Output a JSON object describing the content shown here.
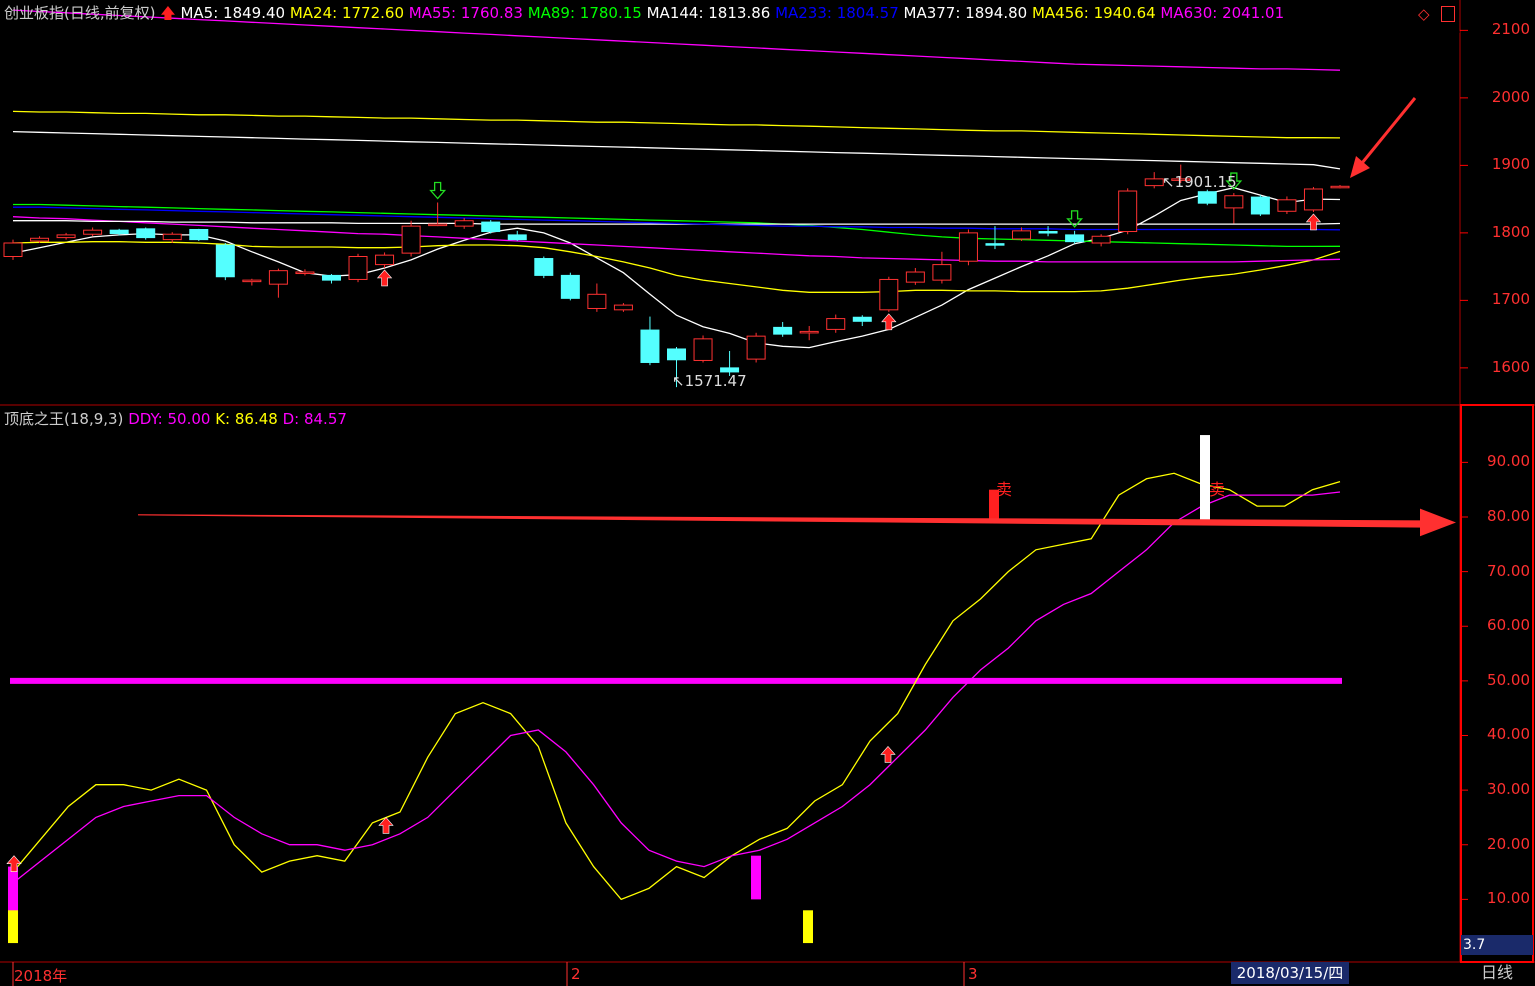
{
  "main_header": {
    "index_name": "创业板指(日线,前复权)",
    "ma": [
      {
        "label": "MA5: 1849.40",
        "color": "#ffffff"
      },
      {
        "label": "MA24: 1772.60",
        "color": "#ffff00"
      },
      {
        "label": "MA55: 1760.83",
        "color": "#ff00ff"
      },
      {
        "label": "MA89: 1780.15",
        "color": "#00ff00"
      },
      {
        "label": "MA144: 1813.86",
        "color": "#ffffff"
      },
      {
        "label": "MA233: 1804.57",
        "color": "#0000ff"
      },
      {
        "label": "MA377: 1894.80",
        "color": "#ffffff"
      },
      {
        "label": "MA456: 1940.64",
        "color": "#ffff00"
      },
      {
        "label": "MA630: 2041.01",
        "color": "#ff00ff"
      }
    ],
    "icons": [
      "diamond-icon",
      "panel-toggle-icon"
    ]
  },
  "sub_header": {
    "name": "顶底之王(18,9,3)",
    "ddy": "DDY: 50.00",
    "k": "K: 86.48",
    "d": "D: 84.57"
  },
  "price_axis": [
    "2100",
    "2000",
    "1900",
    "1800",
    "1700",
    "1600"
  ],
  "indicator_axis": [
    "90.00",
    "80.00",
    "70.00",
    "60.00",
    "50.00",
    "40.00",
    "30.00",
    "20.00",
    "10.00"
  ],
  "bottom_bar": {
    "dates": [
      "2018年",
      "2",
      "3"
    ],
    "cursor_date": "2018/03/15/四",
    "cursor_value": "3.7",
    "period_button": "日线"
  },
  "annotations": {
    "high_label": "1901.15",
    "low_label": "1571.47",
    "sell_label_1": "卖",
    "sell_label_2": "卖"
  },
  "chart_data": [
    {
      "type": "candlestick",
      "title": "创业板指(日线,前复权)",
      "ylim": [
        1545,
        2145
      ],
      "candles": [
        {
          "o": 1765,
          "c": 1785,
          "h": 1790,
          "l": 1760
        },
        {
          "o": 1788,
          "c": 1792,
          "h": 1795,
          "l": 1785
        },
        {
          "o": 1793,
          "c": 1797,
          "h": 1800,
          "l": 1790
        },
        {
          "o": 1798,
          "c": 1804,
          "h": 1808,
          "l": 1795
        },
        {
          "o": 1804,
          "c": 1799,
          "h": 1806,
          "l": 1796
        },
        {
          "o": 1806,
          "c": 1793,
          "h": 1808,
          "l": 1790
        },
        {
          "o": 1790,
          "c": 1798,
          "h": 1801,
          "l": 1785
        },
        {
          "o": 1805,
          "c": 1790,
          "h": 1806,
          "l": 1788
        },
        {
          "o": 1782,
          "c": 1735,
          "h": 1785,
          "l": 1730
        },
        {
          "o": 1728,
          "c": 1730,
          "h": 1732,
          "l": 1722
        },
        {
          "o": 1724,
          "c": 1744,
          "h": 1747,
          "l": 1704
        },
        {
          "o": 1740,
          "c": 1742,
          "h": 1746,
          "l": 1737
        },
        {
          "o": 1737,
          "c": 1730,
          "h": 1739,
          "l": 1725
        },
        {
          "o": 1731,
          "c": 1765,
          "h": 1769,
          "l": 1727
        },
        {
          "o": 1753,
          "c": 1767,
          "h": 1771,
          "l": 1748
        },
        {
          "o": 1770,
          "c": 1810,
          "h": 1818,
          "l": 1765
        },
        {
          "o": 1812,
          "c": 1813,
          "h": 1845,
          "l": 1810
        },
        {
          "o": 1810,
          "c": 1818,
          "h": 1822,
          "l": 1806
        },
        {
          "o": 1816,
          "c": 1802,
          "h": 1819,
          "l": 1799
        },
        {
          "o": 1797,
          "c": 1790,
          "h": 1803,
          "l": 1788
        },
        {
          "o": 1762,
          "c": 1737,
          "h": 1765,
          "l": 1733
        },
        {
          "o": 1737,
          "c": 1703,
          "h": 1741,
          "l": 1700
        },
        {
          "o": 1688,
          "c": 1709,
          "h": 1725,
          "l": 1683
        },
        {
          "o": 1686,
          "c": 1693,
          "h": 1696,
          "l": 1683
        },
        {
          "o": 1656,
          "c": 1608,
          "h": 1676,
          "l": 1604
        },
        {
          "o": 1628,
          "c": 1612,
          "h": 1631,
          "l": 1571.47
        },
        {
          "o": 1611,
          "c": 1643,
          "h": 1648,
          "l": 1608
        },
        {
          "o": 1600,
          "c": 1594,
          "h": 1625,
          "l": 1588
        },
        {
          "o": 1613,
          "c": 1647,
          "h": 1652,
          "l": 1608
        },
        {
          "o": 1660,
          "c": 1650,
          "h": 1668,
          "l": 1646
        },
        {
          "o": 1652,
          "c": 1654,
          "h": 1662,
          "l": 1641
        },
        {
          "o": 1657,
          "c": 1673,
          "h": 1679,
          "l": 1652
        },
        {
          "o": 1675,
          "c": 1669,
          "h": 1678,
          "l": 1662
        },
        {
          "o": 1686,
          "c": 1731,
          "h": 1735,
          "l": 1683
        },
        {
          "o": 1727,
          "c": 1742,
          "h": 1748,
          "l": 1723
        },
        {
          "o": 1730,
          "c": 1753,
          "h": 1772,
          "l": 1725
        },
        {
          "o": 1758,
          "c": 1800,
          "h": 1805,
          "l": 1752
        },
        {
          "o": 1784,
          "c": 1782,
          "h": 1810,
          "l": 1776
        },
        {
          "o": 1791,
          "c": 1803,
          "h": 1808,
          "l": 1788
        },
        {
          "o": 1802,
          "c": 1800,
          "h": 1810,
          "l": 1795
        },
        {
          "o": 1797,
          "c": 1787,
          "h": 1803,
          "l": 1784
        },
        {
          "o": 1785,
          "c": 1795,
          "h": 1798,
          "l": 1780
        },
        {
          "o": 1802,
          "c": 1862,
          "h": 1866,
          "l": 1798
        },
        {
          "o": 1870,
          "c": 1880,
          "h": 1890,
          "l": 1866
        },
        {
          "o": 1880,
          "c": 1880,
          "h": 1901.15,
          "l": 1874
        },
        {
          "o": 1861,
          "c": 1844,
          "h": 1864,
          "l": 1841
        },
        {
          "o": 1837,
          "c": 1855,
          "h": 1859,
          "l": 1814
        },
        {
          "o": 1853,
          "c": 1828,
          "h": 1856,
          "l": 1825
        },
        {
          "o": 1832,
          "c": 1849,
          "h": 1854,
          "l": 1828
        },
        {
          "o": 1834,
          "c": 1865,
          "h": 1868,
          "l": 1831
        },
        {
          "o": 1868,
          "c": 1869,
          "h": 1871,
          "l": 1866
        }
      ],
      "moving_averages": [
        {
          "name": "MA5",
          "color": "#ffffff",
          "values": [
            1770,
            1778,
            1786,
            1794,
            1797,
            1799,
            1797,
            1797,
            1788,
            1772,
            1757,
            1741,
            1736,
            1738,
            1748,
            1760,
            1776,
            1789,
            1801,
            1807,
            1800,
            1785,
            1763,
            1741,
            1709,
            1678,
            1661,
            1651,
            1637,
            1632,
            1630,
            1639,
            1647,
            1657,
            1675,
            1693,
            1716,
            1733,
            1750,
            1766,
            1784,
            1792,
            1804,
            1825,
            1848,
            1858,
            1867,
            1856,
            1845,
            1850,
            1849.4
          ]
        },
        {
          "name": "MA24",
          "color": "#ffff00",
          "values": [
            1785,
            1786,
            1786,
            1787,
            1787,
            1786,
            1786,
            1785,
            1783,
            1780,
            1779,
            1779,
            1779,
            1778,
            1778,
            1779,
            1781,
            1782,
            1782,
            1781,
            1778,
            1772,
            1765,
            1757,
            1748,
            1737,
            1730,
            1725,
            1720,
            1715,
            1712,
            1712,
            1712,
            1713,
            1715,
            1715,
            1714,
            1714,
            1713,
            1713,
            1713,
            1714,
            1718,
            1724,
            1730,
            1735,
            1739,
            1745,
            1752,
            1760,
            1772.6
          ]
        },
        {
          "name": "MA55",
          "color": "#ff00ff",
          "values": [
            1824,
            1822,
            1821,
            1819,
            1817,
            1815,
            1813,
            1811,
            1809,
            1807,
            1805,
            1803,
            1801,
            1799,
            1798,
            1796,
            1794,
            1792,
            1790,
            1788,
            1786,
            1784,
            1782,
            1780,
            1778,
            1776,
            1774,
            1772,
            1770,
            1768,
            1766,
            1765,
            1763,
            1762,
            1761,
            1760,
            1759,
            1758,
            1758,
            1757,
            1757,
            1757,
            1757,
            1757,
            1757,
            1757,
            1757,
            1758,
            1759,
            1760,
            1760.83
          ]
        },
        {
          "name": "MA89",
          "color": "#00ff00",
          "values": [
            1842,
            1842,
            1841,
            1840,
            1839,
            1838,
            1837,
            1836,
            1835,
            1834,
            1833,
            1832,
            1831,
            1830,
            1829,
            1828,
            1827,
            1826,
            1825,
            1824,
            1823,
            1822,
            1821,
            1820,
            1819,
            1818,
            1817,
            1816,
            1815,
            1813,
            1811,
            1808,
            1805,
            1801,
            1797,
            1794,
            1792,
            1791,
            1790,
            1789,
            1788,
            1787,
            1786,
            1785,
            1784,
            1783,
            1782,
            1781,
            1780,
            1780,
            1780.15
          ]
        },
        {
          "name": "MA144",
          "color": "#ffffff",
          "values": [
            1818,
            1818,
            1818,
            1817,
            1817,
            1817,
            1816,
            1816,
            1816,
            1815,
            1815,
            1815,
            1815,
            1814,
            1814,
            1814,
            1814,
            1814,
            1813,
            1813,
            1813,
            1813,
            1813,
            1813,
            1813,
            1813,
            1813,
            1813,
            1813,
            1813,
            1813,
            1813,
            1813,
            1813,
            1813,
            1813,
            1813,
            1813,
            1813,
            1813,
            1813,
            1813,
            1813,
            1813,
            1813,
            1813,
            1813,
            1813,
            1813,
            1813,
            1813.86
          ]
        },
        {
          "name": "MA233",
          "color": "#0000ff",
          "values": [
            1838,
            1838,
            1837,
            1836,
            1835,
            1834,
            1833,
            1832,
            1831,
            1830,
            1829,
            1828,
            1827,
            1826,
            1825,
            1824,
            1823,
            1822,
            1821,
            1820,
            1819,
            1818,
            1817,
            1816,
            1815,
            1814,
            1813,
            1812,
            1811,
            1810,
            1810,
            1809,
            1809,
            1808,
            1808,
            1807,
            1807,
            1806,
            1806,
            1806,
            1805,
            1805,
            1805,
            1805,
            1805,
            1805,
            1805,
            1805,
            1805,
            1805,
            1804.57
          ]
        },
        {
          "name": "MA377",
          "color": "#ffffff",
          "values": [
            1950,
            1949,
            1948,
            1947,
            1946,
            1945,
            1944,
            1943,
            1942,
            1941,
            1940,
            1939,
            1938,
            1937,
            1936,
            1935,
            1934,
            1933,
            1932,
            1931,
            1930,
            1929,
            1928,
            1927,
            1926,
            1925,
            1924,
            1923,
            1922,
            1921,
            1920,
            1919,
            1918,
            1917,
            1916,
            1915,
            1914,
            1913,
            1912,
            1911,
            1910,
            1909,
            1908,
            1907,
            1906,
            1905,
            1904,
            1903,
            1902,
            1901,
            1894.8
          ]
        },
        {
          "name": "MA456",
          "color": "#ffff00",
          "values": [
            1980,
            1979,
            1979,
            1978,
            1977,
            1977,
            1976,
            1975,
            1975,
            1974,
            1973,
            1973,
            1972,
            1971,
            1970,
            1970,
            1969,
            1968,
            1967,
            1967,
            1966,
            1965,
            1964,
            1964,
            1963,
            1962,
            1961,
            1960,
            1960,
            1959,
            1958,
            1957,
            1956,
            1955,
            1954,
            1953,
            1952,
            1951,
            1951,
            1950,
            1949,
            1948,
            1947,
            1946,
            1945,
            1944,
            1943,
            1942,
            1941,
            1941,
            1940.64
          ]
        },
        {
          "name": "MA630",
          "color": "#ff00ff",
          "values": [
            2130,
            2128,
            2126,
            2124,
            2122,
            2120,
            2118,
            2116,
            2114,
            2112,
            2110,
            2108,
            2106,
            2104,
            2102,
            2100,
            2098,
            2096,
            2094,
            2092,
            2090,
            2088,
            2086,
            2084,
            2082,
            2080,
            2078,
            2076,
            2074,
            2072,
            2070,
            2068,
            2066,
            2064,
            2062,
            2060,
            2058,
            2056,
            2054,
            2052,
            2050,
            2049,
            2048,
            2047,
            2046,
            2045,
            2044,
            2043,
            2043,
            2042,
            2041.01
          ]
        }
      ],
      "signals": {
        "up_arrows": [
          14,
          33,
          49
        ],
        "down_arrows": [
          16,
          40,
          46
        ]
      }
    },
    {
      "type": "line",
      "title": "顶底之王(18,9,3)",
      "ylim": [
        0,
        100
      ],
      "ddy": 50,
      "series": [
        {
          "name": "K",
          "color": "#ffff00",
          "values": [
            15,
            21,
            27,
            31,
            31,
            30,
            32,
            30,
            20,
            15,
            17,
            18,
            17,
            24,
            26,
            36,
            44,
            46,
            44,
            38,
            24,
            16,
            10,
            12,
            16,
            14,
            18,
            21,
            23,
            28,
            31,
            39,
            44,
            53,
            61,
            65,
            70,
            74,
            75,
            76,
            84,
            87,
            88,
            86,
            85,
            82,
            82,
            85,
            86.48
          ]
        },
        {
          "name": "D",
          "color": "#ff00ff",
          "values": [
            13,
            17,
            21,
            25,
            27,
            28,
            29,
            29,
            25,
            22,
            20,
            20,
            19,
            20,
            22,
            25,
            30,
            35,
            40,
            41,
            37,
            31,
            24,
            19,
            17,
            16,
            18,
            19,
            21,
            24,
            27,
            31,
            36,
            41,
            47,
            52,
            56,
            61,
            64,
            66,
            70,
            74,
            79,
            82,
            84,
            84,
            84,
            84,
            84.57
          ]
        }
      ],
      "markers": {
        "magenta_bars": [
          0,
          27
        ],
        "yellow_bars": [
          0,
          29
        ],
        "red_up_arrows": [
          0,
          14,
          33
        ],
        "sell_bars": [
          {
            "index": 37,
            "color": "#ff0000"
          },
          {
            "index": 44,
            "color": "#ffffff"
          }
        ]
      }
    }
  ]
}
